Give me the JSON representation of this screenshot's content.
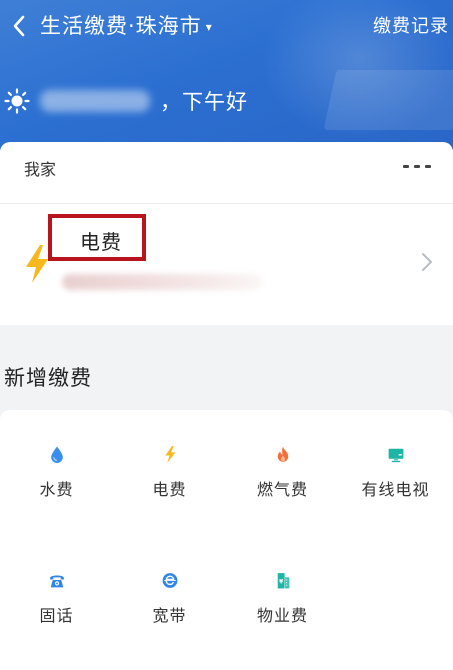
{
  "header": {
    "title": "生活缴费·珠海市",
    "city_dropdown": "▾",
    "records_label": "缴费记录",
    "greeting": "，下午好"
  },
  "home": {
    "label": "我家",
    "bill": {
      "name": "电费",
      "icon": "lightning-icon"
    }
  },
  "new_payment": {
    "title": "新增缴费",
    "items": [
      {
        "label": "水费",
        "icon": "water-drop-icon",
        "color": "#3a8ef0"
      },
      {
        "label": "电费",
        "icon": "lightning-icon",
        "color": "#f6b81c"
      },
      {
        "label": "燃气费",
        "icon": "flame-icon",
        "color": "#f2703c"
      },
      {
        "label": "有线电视",
        "icon": "tv-icon",
        "color": "#1fb5a4"
      },
      {
        "label": "固话",
        "icon": "telephone-icon",
        "color": "#2f86e8"
      },
      {
        "label": "宽带",
        "icon": "broadband-icon",
        "color": "#2f86e8"
      },
      {
        "label": "物业费",
        "icon": "building-icon",
        "color": "#1fb5a4"
      }
    ]
  },
  "colors": {
    "header_blue": "#2b6fd1",
    "highlight_red": "#b8141d",
    "bolt_yellow": "#f6b81c"
  }
}
